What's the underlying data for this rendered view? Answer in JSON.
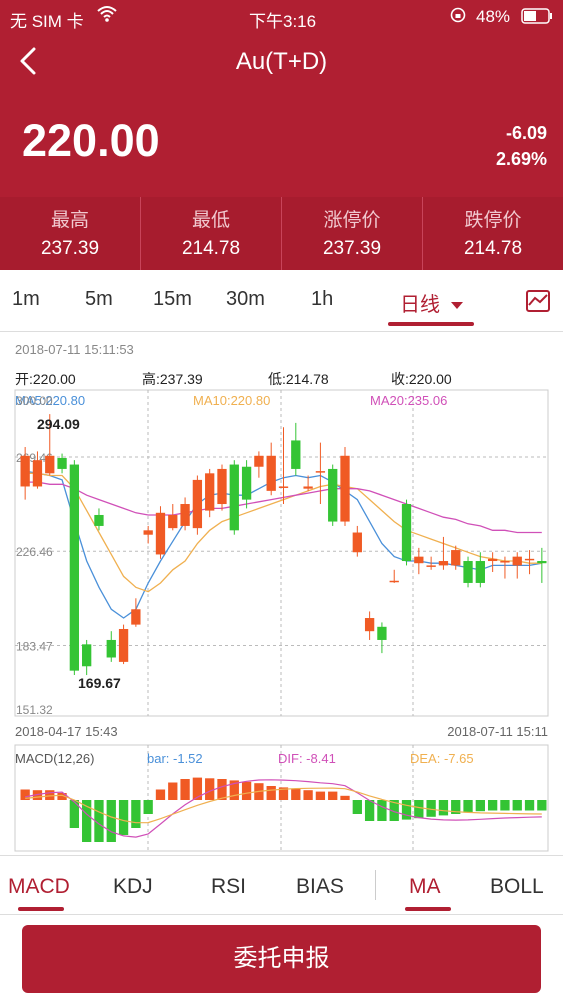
{
  "status": {
    "carrier": "无 SIM 卡",
    "time": "下午3:16",
    "battery": "48%"
  },
  "header": {
    "title": "Au(T+D)",
    "price": "220.00",
    "change": "-6.09",
    "change_pct": "2.69%"
  },
  "stats": [
    {
      "label": "最高",
      "value": "237.39"
    },
    {
      "label": "最低",
      "value": "214.78"
    },
    {
      "label": "涨停价",
      "value": "237.39"
    },
    {
      "label": "跌停价",
      "value": "214.78"
    }
  ],
  "periods": [
    "1m",
    "5m",
    "15m",
    "30m",
    "1h",
    "日线"
  ],
  "active_period": "日线",
  "chart_info": {
    "timestamp": "2018-07-11 15:11:53",
    "open": "开:220.00",
    "high": "高:237.39",
    "low": "低:214.78",
    "close": "收:220.00",
    "ma5": "MA5:220.80",
    "ma10": "MA10:220.80",
    "ma20": "MA20:235.06",
    "yticks": [
      "300.00",
      "269.46",
      "226.46",
      "183.47",
      "151.32"
    ],
    "max_label": "294.09",
    "min_label": "169.67",
    "date_start": "2018-04-17 15:43",
    "date_end": "2018-07-11 15:11",
    "macd": "MACD(12,26)",
    "bar": "bar: -1.52",
    "dif": "DIF: -8.41",
    "dea": "DEA: -7.65"
  },
  "indicators": [
    "MACD",
    "KDJ",
    "RSI",
    "BIAS",
    "MA",
    "BOLL"
  ],
  "action_button": "委托申报",
  "colors": {
    "brand": "#b01f32",
    "up": "#f05a24",
    "down": "#34c434",
    "ma5": "#4a90d9",
    "ma10": "#f0b050",
    "ma20": "#d050b8"
  },
  "chart_data": {
    "type": "candlestick",
    "ylim": [
      151.32,
      300.0
    ],
    "candles": [
      {
        "o": 256,
        "c": 270,
        "h": 274,
        "l": 250
      },
      {
        "o": 256,
        "c": 268,
        "h": 272,
        "l": 255
      },
      {
        "o": 262,
        "c": 270,
        "h": 289,
        "l": 261
      },
      {
        "o": 269,
        "c": 264,
        "h": 271,
        "l": 262
      },
      {
        "o": 266,
        "c": 172,
        "h": 268,
        "l": 170
      },
      {
        "o": 184,
        "c": 174,
        "h": 186,
        "l": 170
      },
      {
        "o": 243,
        "c": 238,
        "h": 246,
        "l": 236
      },
      {
        "o": 186,
        "c": 178,
        "h": 190,
        "l": 176
      },
      {
        "o": 176,
        "c": 191,
        "h": 193,
        "l": 175
      },
      {
        "o": 193,
        "c": 200,
        "h": 205,
        "l": 192
      },
      {
        "o": 234,
        "c": 236,
        "h": 238,
        "l": 230
      },
      {
        "o": 225,
        "c": 244,
        "h": 247,
        "l": 223
      },
      {
        "o": 237,
        "c": 243,
        "h": 248,
        "l": 236
      },
      {
        "o": 238,
        "c": 248,
        "h": 251,
        "l": 236
      },
      {
        "o": 237,
        "c": 259,
        "h": 261,
        "l": 234
      },
      {
        "o": 245,
        "c": 262,
        "h": 264,
        "l": 242
      },
      {
        "o": 248,
        "c": 264,
        "h": 266,
        "l": 245
      },
      {
        "o": 266,
        "c": 236,
        "h": 268,
        "l": 234
      },
      {
        "o": 265,
        "c": 250,
        "h": 268,
        "l": 246
      },
      {
        "o": 265,
        "c": 270,
        "h": 272,
        "l": 260
      },
      {
        "o": 254,
        "c": 270,
        "h": 276,
        "l": 252
      },
      {
        "o": 256,
        "c": 256,
        "h": 283,
        "l": 248
      },
      {
        "o": 277,
        "c": 264,
        "h": 285,
        "l": 261
      },
      {
        "o": 255,
        "c": 256,
        "h": 261,
        "l": 254
      },
      {
        "o": 263,
        "c": 263,
        "h": 276,
        "l": 248
      },
      {
        "o": 264,
        "c": 240,
        "h": 266,
        "l": 238
      },
      {
        "o": 240,
        "c": 270,
        "h": 274,
        "l": 238
      },
      {
        "o": 226,
        "c": 235,
        "h": 238,
        "l": 224
      },
      {
        "o": 190,
        "c": 196,
        "h": 199,
        "l": 186
      },
      {
        "o": 192,
        "c": 186,
        "h": 194,
        "l": 180
      },
      {
        "o": 213,
        "c": 213,
        "h": 218,
        "l": 212
      },
      {
        "o": 248,
        "c": 222,
        "h": 250,
        "l": 220
      },
      {
        "o": 221,
        "c": 224,
        "h": 228,
        "l": 216
      },
      {
        "o": 220,
        "c": 220,
        "h": 224,
        "l": 218
      },
      {
        "o": 220,
        "c": 222,
        "h": 233,
        "l": 218
      },
      {
        "o": 220,
        "c": 227,
        "h": 229,
        "l": 218
      },
      {
        "o": 222,
        "c": 212,
        "h": 224,
        "l": 210
      },
      {
        "o": 222,
        "c": 212,
        "h": 226,
        "l": 210
      },
      {
        "o": 222,
        "c": 223,
        "h": 226,
        "l": 217
      },
      {
        "o": 222,
        "c": 222,
        "h": 224,
        "l": 214
      },
      {
        "o": 220,
        "c": 224,
        "h": 226,
        "l": 214
      },
      {
        "o": 223,
        "c": 223,
        "h": 227,
        "l": 216
      },
      {
        "o": 222,
        "c": 221,
        "h": 228,
        "l": 212
      }
    ],
    "ma5": [
      263,
      262,
      261,
      259,
      240,
      222,
      210,
      200,
      196,
      200,
      212,
      222,
      231,
      240,
      248,
      252,
      253,
      252,
      252,
      255,
      258,
      260,
      261,
      260,
      261,
      258,
      254,
      250,
      240,
      230,
      224,
      222,
      222,
      221,
      221,
      220,
      219,
      218,
      220,
      220,
      220,
      220,
      221
    ],
    "ma10": [
      262,
      262,
      261,
      261,
      255,
      245,
      235,
      225,
      215,
      210,
      208,
      212,
      218,
      222,
      230,
      236,
      240,
      242,
      244,
      246,
      248,
      250,
      252,
      254,
      256,
      257,
      256,
      255,
      250,
      245,
      240,
      236,
      234,
      232,
      230,
      228,
      226,
      224,
      223,
      222,
      222,
      221,
      221
    ],
    "ma20": [
      258,
      258,
      257,
      257,
      255,
      252,
      250,
      248,
      246,
      244,
      243,
      243,
      243,
      244,
      245,
      246,
      246,
      247,
      248,
      249,
      250,
      251,
      252,
      253,
      254,
      255,
      255,
      255,
      254,
      252,
      250,
      248,
      246,
      244,
      242,
      241,
      239,
      238,
      236,
      236,
      235,
      235,
      235
    ],
    "macd_bars": [
      1.5,
      1.4,
      1.4,
      1.0,
      -4,
      -6,
      -6,
      -6,
      -5,
      -4,
      -2,
      1.5,
      2.5,
      3,
      3.2,
      3.1,
      3,
      2.8,
      2.6,
      2.4,
      2,
      1.8,
      1.6,
      1.4,
      1.2,
      1.2,
      0.6,
      -2,
      -3,
      -3,
      -3,
      -2.8,
      -2.6,
      -2.4,
      -2.2,
      -2,
      -1.8,
      -1.6,
      -1.5,
      -1.5,
      -1.5,
      -1.5,
      -1.5
    ]
  }
}
